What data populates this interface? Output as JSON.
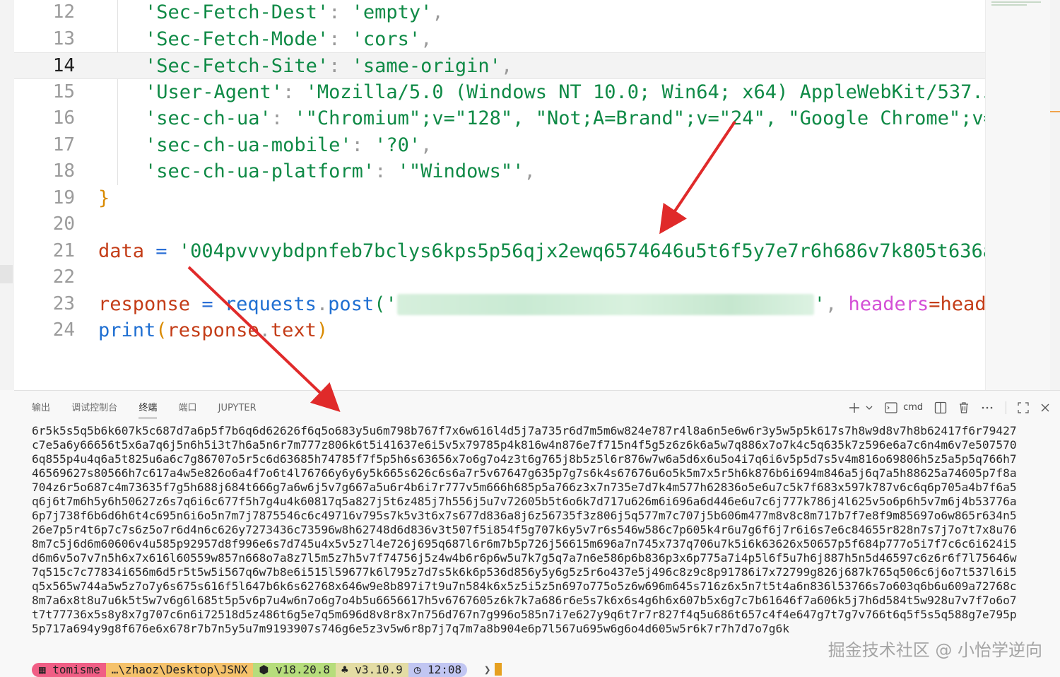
{
  "editor": {
    "lines": [
      {
        "num": "12",
        "key": "'Sec-Fetch-Dest'",
        "value": "'empty'"
      },
      {
        "num": "13",
        "key": "'Sec-Fetch-Mode'",
        "value": "'cors'"
      },
      {
        "num": "14",
        "key": "'Sec-Fetch-Site'",
        "value": "'same-origin'"
      },
      {
        "num": "15",
        "key": "'User-Agent'",
        "value": "'Mozilla/5.0 (Windows NT 10.0; Win64; x64) AppleWebKit/537.3"
      },
      {
        "num": "16",
        "key": "'sec-ch-ua'",
        "value": "'\"Chromium\";v=\"128\", \"Not;A=Brand\";v=\"24\", \"Google Chrome\";v="
      },
      {
        "num": "17",
        "key": "'sec-ch-ua-mobile'",
        "value": "'?0'"
      },
      {
        "num": "18",
        "key": "'sec-ch-ua-platform'",
        "value": "'\"Windows\"'"
      },
      {
        "num": "19",
        "text": "}"
      },
      {
        "num": "20",
        "text": ""
      },
      {
        "num": "21",
        "var": "data",
        "eq": "=",
        "value": "'004pvvvybdpnfeb7bclys6kps5p56qjx2ewq6574646u5t6f5y7e7r6h686v7k805t636a"
      },
      {
        "num": "22",
        "text": ""
      },
      {
        "num": "23",
        "var": "response",
        "eq": "=",
        "obj": "requests",
        "dot": ".",
        "method": "post",
        "open": "('",
        "close": "'",
        "kwarg": "headers",
        "kweq": "=",
        "kwval": "head"
      },
      {
        "num": "24",
        "fn": "print",
        "open": "(",
        "arg": "response",
        "dot": ".",
        "attr": "text",
        "close": ")"
      }
    ]
  },
  "panel": {
    "tabs": [
      "输出",
      "调试控制台",
      "终端",
      "端口",
      "JUPYTER"
    ],
    "active_tab": "终端",
    "shell_label": "cmd",
    "terminal_lines": [
      "6r5k5s5q5b6k607k5c687d7a6p5f7b6q6d62626f6q5o683y5u6m798b767f7x6w616l4d5j7a735r6d7m5m6w824e787r4l8a6n5e6w6r3y5w5p5k617s7h8w9d8v7h8b62417f6r79427",
      "c7e5a6y66656t5x6a7q6j5n6h5i3t7h6a5n6r7m777z806k6t5i41637e6i5v5x79785p4k816w4n876e7f715n4f5g5z6z6k6a5w7q886x7o7k4c5q635k7z596e6a7c6n4m6v7e507570",
      "6q855p4u4q6a5t825u6a6c7g86707o5r5c6d63685h74785f7f5p5h6s63656x7o6g7o4z3t6g765j8b5z5l6r876w7w6a5d6x6u5o4i7q6i6v5p5d7s5v4m816o69806h5z5a5p5q766h7",
      "46569627s80566h7c617a4w5e826o6a4f7o6t4l76766y6y6y5k665s626c6s6a7r5v67647g635p7g7s6k4s67676u6o5k5m7x5r5h6k876b6i694m846a5j6q7a5h88625a74605p7f8a",
      "704z6r5o687c4m73635f7g5h688j684t666g7a6w6j5v7g667a5u6r4b6i7r777v5m666h685p5a766z3x7n735e7d7k4m577h62836o5e6u7c5k7f683x597k787v6c6q6p705a4b7f6a5",
      "q6j6t7m6h5y6h50627z6s7q6i6c677f5h7g4u4k60817q5a827j5t6z485j7h556j5u7v72605b5t6o6k7d717u626m6i696a6d446e6u7c6j777k786j4l625v5o6p6h5v7m6j4b53776a",
      "6p7j738f6b6d6h6t4c695n6i6o5n7m7j7875546c6c49716v795s7k5v3t6x7s677d836a8j6z56735f3z806j5q577m7c707j5b606m477m8v8c8m717b7f7e8f9m85697o6w865r634n5",
      "26e7p5r4t6p7c7s6z5o7r6d4n6c626y7273436c73596w8h62748d6d836v3t507f5i854f5g707k6y5v7r6s546w586c7p605k4r6u7g6f6j7r6i6s7e6c84655r828n7s7j7o7t7x8u76",
      "8m7c5j6d6m60606v4u585p92957d8f996e6s7d745u4x5v5z7l4e726j695q687l6r6m7b5p726j56615m696a7n745x737q706u7k5i6k63626x50657p5f684p777o5i7f7c6c6i624i5",
      "d6m6v5o7v7n5h6x7x616l60559w857n668o7a8z7l5m5z7h5v7f74756j5z4w4b6r6p6w5u7k7g5q7a7n6e586p6b836p3x6p775a7i4p5l6f5u7h6j887h5n5d46597c6z6r6f7l75646w",
      "7q515c7c77834i656m6d5r5t5w5i567q6w7b8e6i515l59677k6l795z7d7s5k6k6p536d856y5y6g5z5r6o437e5j496c8z9c8p91786i7x72799g826j687k765q506c6j6o7t537l6i5",
      "q5x565w744a5w5z7o7y6s675s616f5l647b6k6s62768x646w9e8b897i7t9u7n584k6x5z5i5z5n697o775o5z6w696m645s716z6x5n7t5t4a6n836l53766s7o603q6b6u609a72768c",
      "8m7a6x8t8u7u6k5t5w7v6g6l685t5p5v6p7u4w6n7o6g7o4b5u6656617h5v6767605z6k7k7a686r6e5s7k6x6s4g6h6x607b5x6g7c7b61646f7a606k5j7h6d584t5w928u7v7f7o6o7",
      "t7t77736x5s8y8x7g707c6n6i72518d5z486t6g5e7q5m696d8v8r8x7n756d767n7g996o585n7i7e627y9q6t7r7r827f4q5u686t657c4f4e647g7t7g7v766t6q5f5s5q588g7e795p",
      "5p717a694y9g8f676e6x678r7b7n5y5u7m9193907s746g6e5z3v5w6r8p7j7q7m7a8b904e6p7l567u695w6g6o4d605w5r6k7r7h7d7o7g6k"
    ],
    "watermark": "掘金技术社区 @ 小怡学逆向",
    "prompt": {
      "user": "tomisme",
      "path": "…\\zhaoz\\Desktop\\JSNX",
      "node": "v18.20.8",
      "python": "v3.10.9",
      "time": "12:08",
      "caret": "❯"
    }
  },
  "colors": {
    "string": "#0f8a46",
    "variable": "#c43d18",
    "keyword_arg": "#d44fd6",
    "function": "#1f6fd2",
    "annotation_arrow": "#e02a2a"
  },
  "icons": [
    "plus-icon",
    "chevron-down-icon",
    "terminal-icon",
    "split-icon",
    "trash-icon",
    "more-icon",
    "maximize-icon",
    "close-icon",
    "windows-icon",
    "node-icon",
    "python-icon",
    "clock-icon"
  ]
}
